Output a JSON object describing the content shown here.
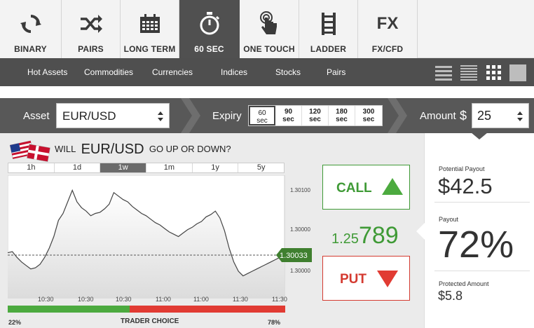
{
  "tabs": [
    {
      "label": "BINARY",
      "icon": "refresh-icon"
    },
    {
      "label": "PAIRS",
      "icon": "shuffle-icon"
    },
    {
      "label": "LONG TERM",
      "icon": "calendar-icon"
    },
    {
      "label": "60 SEC",
      "icon": "stopwatch-icon",
      "active": true
    },
    {
      "label": "ONE TOUCH",
      "icon": "touch-hand-icon"
    },
    {
      "label": "LADDER",
      "icon": "ladder-icon"
    },
    {
      "label": "FX/CFD",
      "icon_text": "FX"
    }
  ],
  "subnav": [
    "Hot Assets",
    "Commodities",
    "Currencies",
    "Indices",
    "Stocks",
    "Pairs"
  ],
  "assetbar": {
    "asset_label": "Asset",
    "asset_value": "EUR/USD",
    "expiry_label": "Expiry",
    "expiry_options": [
      {
        "value": "60",
        "unit": "sec",
        "active": true
      },
      {
        "value": "90",
        "unit": "sec"
      },
      {
        "value": "120",
        "unit": "sec"
      },
      {
        "value": "180",
        "unit": "sec"
      },
      {
        "value": "300",
        "unit": "sec"
      }
    ],
    "amount_label": "Amount",
    "currency_symbol": "$",
    "amount_value": "25"
  },
  "question": {
    "prefix": "WILL",
    "pair": "EUR/USD",
    "suffix": "GO UP OR DOWN?"
  },
  "ranges": [
    {
      "label": "1h"
    },
    {
      "label": "1d"
    },
    {
      "label": "1w",
      "active": true
    },
    {
      "label": "1m"
    },
    {
      "label": "1y"
    },
    {
      "label": "5y"
    }
  ],
  "chart_data": {
    "type": "area",
    "x_tick_labels": [
      "10:30",
      "10:30",
      "10:30",
      "11:00",
      "11:00",
      "11:30",
      "11:30"
    ],
    "y_tick_labels": [
      "1.30100",
      "1.30000",
      "1.30000"
    ],
    "current_value_label": "1.30033",
    "ylim": [
      0,
      100
    ],
    "grid": false,
    "series": [
      {
        "x": [
          0,
          1,
          2,
          3,
          4,
          5,
          6,
          7,
          8,
          9,
          10,
          11,
          12,
          13,
          14,
          15,
          16,
          17,
          18,
          19,
          20,
          21,
          22,
          23,
          24,
          25,
          26,
          27,
          28,
          29,
          30,
          31,
          32,
          33,
          34,
          35,
          36,
          37,
          38,
          39,
          40,
          41,
          42,
          43,
          44,
          45,
          46,
          47,
          48,
          49,
          50,
          51,
          52,
          53,
          54,
          55,
          56,
          57,
          58,
          59,
          60
        ],
        "values": [
          36,
          37,
          32,
          28,
          25,
          22,
          23,
          26,
          32,
          40,
          50,
          64,
          70,
          80,
          90,
          80,
          75,
          72,
          68,
          70,
          71,
          74,
          78,
          88,
          85,
          82,
          80,
          76,
          73,
          70,
          68,
          65,
          62,
          60,
          57,
          54,
          52,
          50,
          53,
          56,
          58,
          61,
          63,
          67,
          69,
          72,
          66,
          55,
          40,
          28,
          20,
          16,
          18,
          20,
          22,
          24,
          26,
          28,
          30,
          32,
          34
        ]
      }
    ]
  },
  "sentiment": {
    "left_pct": "22%",
    "label": "TRADER CHOICE",
    "right_pct": "78%",
    "green_fraction": 0.44
  },
  "trade": {
    "call_label": "CALL",
    "put_label": "PUT",
    "price_small": "1.25",
    "price_big": "789"
  },
  "payout": {
    "potential_label": "Potential Payout",
    "potential_value": "$42.5",
    "payout_label": "Payout",
    "payout_value": "72%",
    "protected_label": "Protected Amount",
    "protected_value": "$5.8"
  },
  "colors": {
    "green": "#3f9a36",
    "red": "#e13b33",
    "dark_bar": "#4f4f4f"
  }
}
